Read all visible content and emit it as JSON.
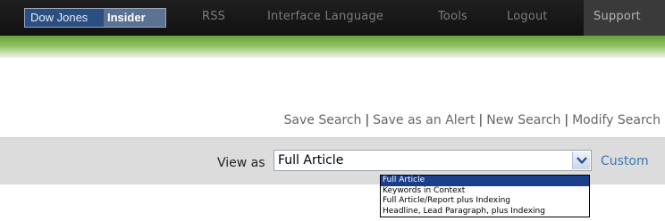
{
  "logo": {
    "part1": "Dow Jones",
    "part2": "Insider"
  },
  "nav": {
    "items": [
      {
        "label": "RSS"
      },
      {
        "label": "Interface Language"
      },
      {
        "label": "Tools"
      },
      {
        "label": "Logout"
      },
      {
        "label": "Support"
      }
    ]
  },
  "search_actions": {
    "items": [
      {
        "label": "Save Search"
      },
      {
        "label": "Save as an Alert"
      },
      {
        "label": "New Search"
      },
      {
        "label": "Modify Search"
      }
    ],
    "separator": "|"
  },
  "view_as": {
    "label": "View as",
    "selected_value": "Full Article",
    "custom_label": "Custom",
    "options": [
      {
        "label": "Full Article"
      },
      {
        "label": "Keywords in Context"
      },
      {
        "label": "Full Article/Report plus Indexing"
      },
      {
        "label": "Headline, Lead Paragraph, plus Indexing"
      }
    ]
  },
  "colors": {
    "nav_background": "#111111",
    "brand_blue": "#2c4f82",
    "band_green": "#8ec062",
    "link_blue": "#3a78b4",
    "selection_blue": "#1b3e8a"
  },
  "icons": {
    "dropdown_arrow": "chevron-down-icon"
  }
}
